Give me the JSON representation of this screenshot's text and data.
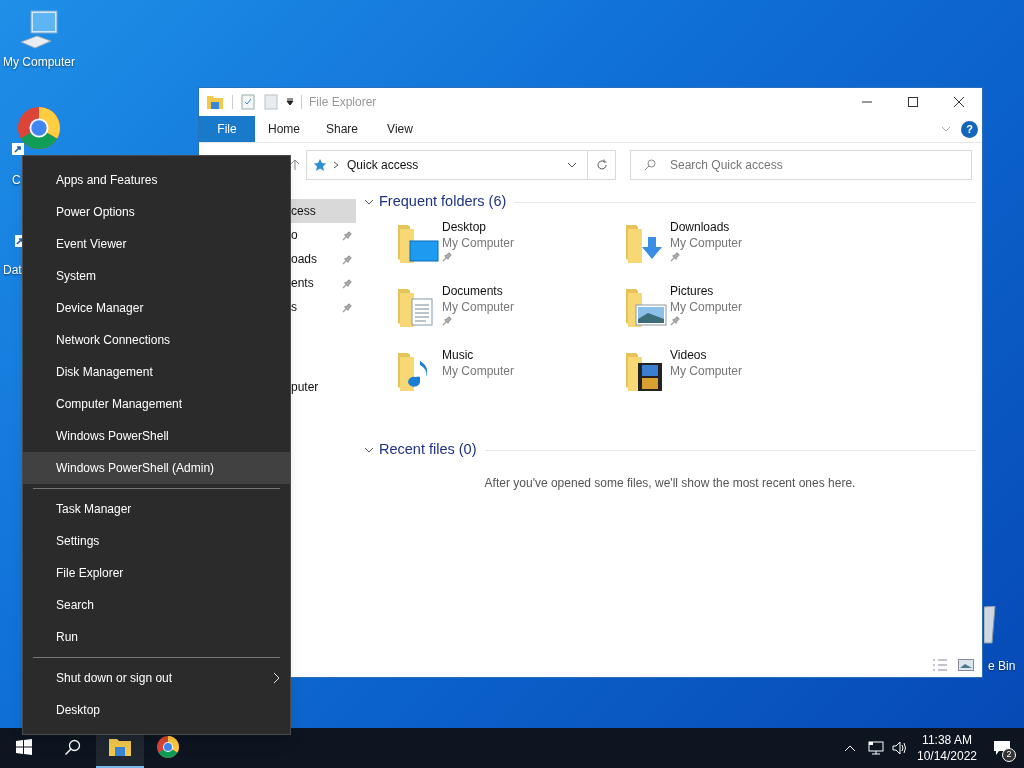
{
  "desktop_icons": [
    {
      "label": "My Computer",
      "kind": "computer"
    },
    {
      "label": "C",
      "kind": "chrome"
    },
    {
      "label": "Dat",
      "kind": "shortcut"
    },
    {
      "label": "e Bin",
      "kind": "recycle"
    }
  ],
  "explorer": {
    "title": "File Explorer",
    "ribbon_tabs": [
      {
        "label": "File",
        "selected": true
      },
      {
        "label": "Home",
        "selected": false
      },
      {
        "label": "Share",
        "selected": false
      },
      {
        "label": "View",
        "selected": false
      }
    ],
    "help": "?",
    "address": "Quick access",
    "search": {
      "placeholder": "Search Quick access"
    },
    "nav_pane": {
      "sections": [
        {
          "items": [
            {
              "label": "cess",
              "selected": true,
              "pinned": false
            },
            {
              "label": "o",
              "selected": false,
              "pinned": true
            },
            {
              "label": "oads",
              "selected": false,
              "pinned": true
            },
            {
              "label": "ents",
              "selected": false,
              "pinned": true
            },
            {
              "label": "s",
              "selected": false,
              "pinned": true
            }
          ]
        },
        {
          "items": [
            {
              "label": "puter",
              "selected": false,
              "pinned": false
            }
          ]
        }
      ]
    },
    "frequent_header": "Frequent folders (6)",
    "folders": [
      {
        "name": "Desktop",
        "location": "My Computer",
        "kind": "desktop",
        "pinned": true
      },
      {
        "name": "Downloads",
        "location": "My Computer",
        "kind": "downloads",
        "pinned": true
      },
      {
        "name": "Documents",
        "location": "My Computer",
        "kind": "documents",
        "pinned": true
      },
      {
        "name": "Pictures",
        "location": "My Computer",
        "kind": "pictures",
        "pinned": true
      },
      {
        "name": "Music",
        "location": "My Computer",
        "kind": "music",
        "pinned": false
      },
      {
        "name": "Videos",
        "location": "My Computer",
        "kind": "videos",
        "pinned": false
      }
    ],
    "recent_header": "Recent files (0)",
    "recent_empty": "After you've opened some files, we'll show the most recent ones here."
  },
  "context_menu": {
    "items": [
      {
        "kind": "item",
        "label": "Apps and Features",
        "selected": false
      },
      {
        "kind": "item",
        "label": "Power Options",
        "selected": false
      },
      {
        "kind": "item",
        "label": "Event Viewer",
        "selected": false
      },
      {
        "kind": "item",
        "label": "System",
        "selected": false
      },
      {
        "kind": "item",
        "label": "Device Manager",
        "selected": false
      },
      {
        "kind": "item",
        "label": "Network Connections",
        "selected": false
      },
      {
        "kind": "item",
        "label": "Disk Management",
        "selected": false
      },
      {
        "kind": "item",
        "label": "Computer Management",
        "selected": false
      },
      {
        "kind": "item",
        "label": "Windows PowerShell",
        "selected": false
      },
      {
        "kind": "item",
        "label": "Windows PowerShell (Admin)",
        "selected": true
      },
      {
        "kind": "separator"
      },
      {
        "kind": "item",
        "label": "Task Manager",
        "selected": false
      },
      {
        "kind": "item",
        "label": "Settings",
        "selected": false
      },
      {
        "kind": "item",
        "label": "File Explorer",
        "selected": false
      },
      {
        "kind": "item",
        "label": "Search",
        "selected": false
      },
      {
        "kind": "item",
        "label": "Run",
        "selected": false
      },
      {
        "kind": "separator"
      },
      {
        "kind": "submenu",
        "label": "Shut down or sign out",
        "selected": false
      },
      {
        "kind": "item",
        "label": "Desktop",
        "selected": false
      }
    ]
  },
  "taskbar": {
    "apps": [
      {
        "kind": "start",
        "active": false
      },
      {
        "kind": "search",
        "active": false
      },
      {
        "kind": "explorer",
        "active": true
      },
      {
        "kind": "chrome",
        "active": false
      }
    ],
    "time": "11:38 AM",
    "date": "10/14/2022",
    "notifications": "2"
  }
}
